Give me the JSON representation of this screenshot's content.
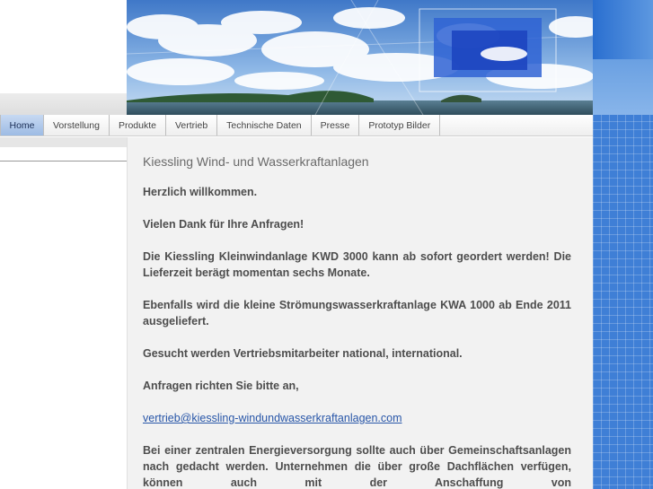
{
  "nav": {
    "items": [
      {
        "label": "Home",
        "active": true
      },
      {
        "label": "Vorstellung",
        "active": false
      },
      {
        "label": "Produkte",
        "active": false
      },
      {
        "label": "Vertrieb",
        "active": false
      },
      {
        "label": "Technische Daten",
        "active": false
      },
      {
        "label": "Presse",
        "active": false
      },
      {
        "label": "Prototyp Bilder",
        "active": false
      }
    ]
  },
  "main": {
    "title": "Kiessling Wind- und Wasserkraftanlagen",
    "paragraphs": [
      "Herzlich willkommen.",
      "Vielen Dank für Ihre Anfragen!",
      "Die Kiessling Kleinwindanlage KWD 3000 kann ab sofort geordert werden! Die Lieferzeit berägt momentan sechs Monate.",
      "Ebenfalls wird die kleine Strömungswasserkraftanlage KWA 1000 ab Ende 2011 ausgeliefert.",
      "Gesucht werden Vertriebsmitarbeiter national, international.",
      "Anfragen richten Sie bitte an,"
    ],
    "email_link": "vertrieb@kiessling-windundwasserkraftanlagen.com",
    "closing_paragraph": "Bei einer zentralen Energieversorgung sollte auch über Gemeinschaftsanlagen nach gedacht werden. Unternehmen die über große Dachflächen verfügen, können auch mit der Anschaffung von"
  },
  "colors": {
    "accent_blue": "#3f7fd6",
    "active_tab": "#9dbbe4",
    "link": "#2856a8"
  }
}
